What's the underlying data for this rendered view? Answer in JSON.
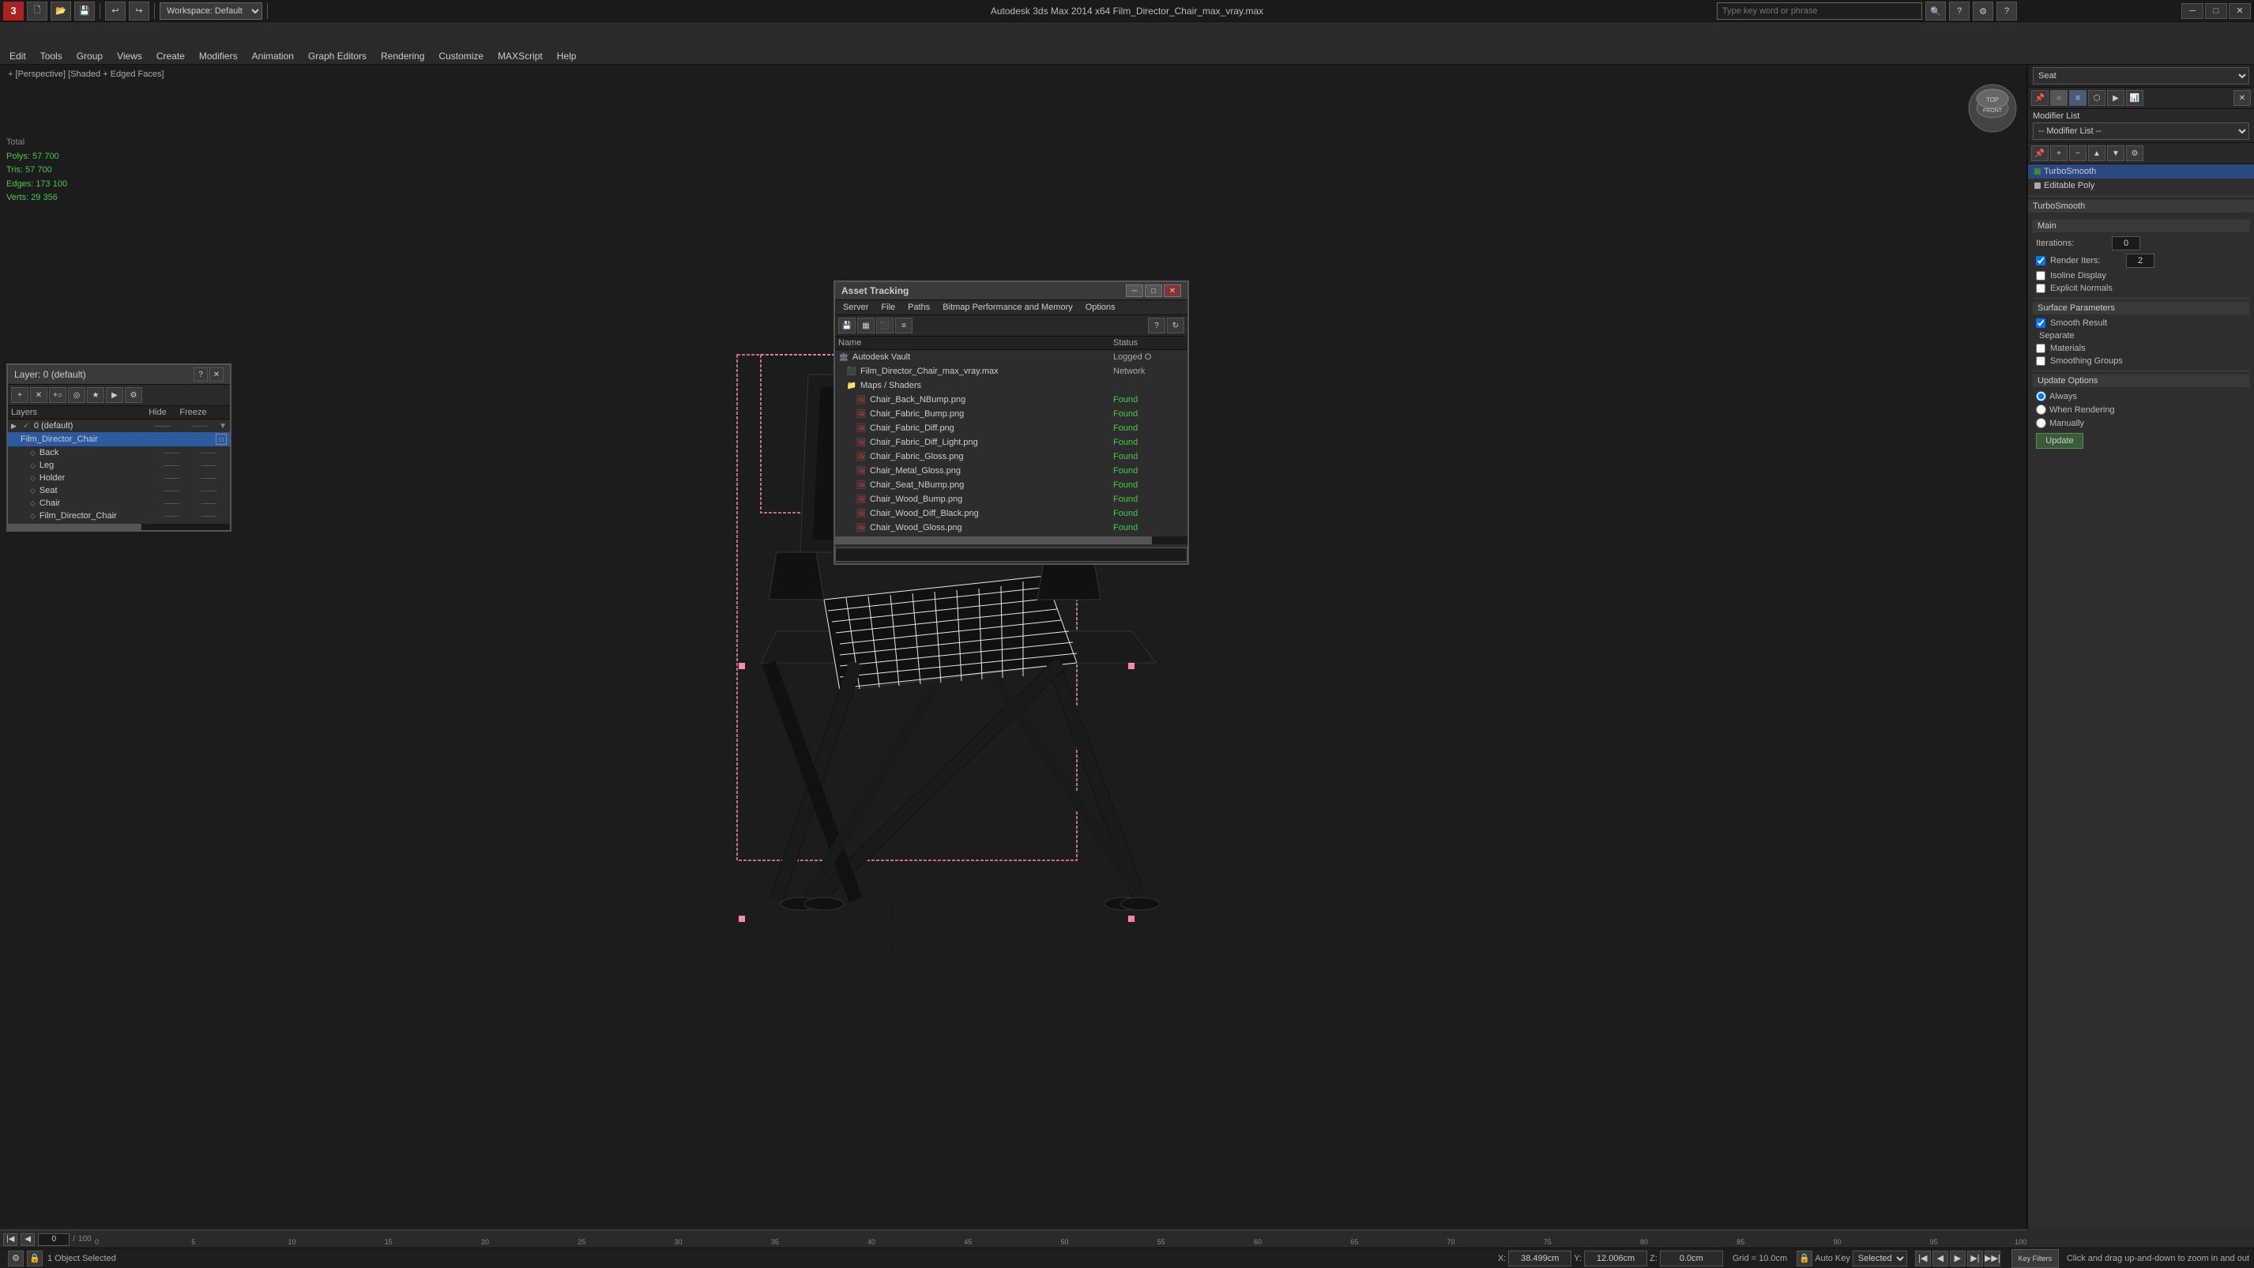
{
  "app": {
    "title": "Autodesk 3ds Max 2014 x64",
    "file": "Film_Director_Chair_max_vray.max",
    "full_title": "Autodesk 3ds Max 2014 x64    Film_Director_Chair_max_vray.max"
  },
  "titlebar": {
    "minimize": "─",
    "maximize": "□",
    "close": "✕",
    "logo": "3"
  },
  "toolbar": {
    "workspace_label": "Workspace: Default",
    "search_placeholder": "Type key word or phrase"
  },
  "menubar": {
    "items": [
      "Edit",
      "Tools",
      "Group",
      "Views",
      "Create",
      "Modifiers",
      "Animation",
      "Graph Editors",
      "Rendering",
      "Customize",
      "MAXScript",
      "Help"
    ]
  },
  "viewport": {
    "label": "+ [Perspective] [Shaded + Edged Faces]"
  },
  "stats": {
    "total_label": "Total",
    "polys_label": "Polys:",
    "polys_value": "57 700",
    "tris_label": "Tris:",
    "tris_value": "57 700",
    "edges_label": "Edges:",
    "edges_value": "173 100",
    "verts_label": "Verts:",
    "verts_value": "29 356"
  },
  "right_panel": {
    "name_label": "Seat",
    "modifier_list_label": "Modifier List",
    "modifiers": [
      {
        "name": "TurboSmooth",
        "type": "green"
      },
      {
        "name": "Editable Poly",
        "type": "white"
      }
    ],
    "turbosmooth": {
      "title": "TurboSmooth",
      "main_label": "Main",
      "iterations_label": "Iterations:",
      "iterations_value": "0",
      "render_iters_label": "Render Iters:",
      "render_iters_value": "2",
      "isoline_label": "Isoline Display",
      "explicit_label": "Explicit Normals",
      "surface_params_label": "Surface Parameters",
      "smooth_result_label": "Smooth Result",
      "separate_label": "Separate",
      "materials_label": "Materials",
      "smoothing_label": "Smoothing Groups",
      "update_options_label": "Update Options",
      "always_label": "Always",
      "when_rendering_label": "When Rendering",
      "manually_label": "Manually",
      "update_btn": "Update"
    },
    "panel_tabs": [
      "pin",
      "obj",
      "mod",
      "hier",
      "motion",
      "disp"
    ]
  },
  "layer_panel": {
    "title": "Layer: 0 (default)",
    "layers": [
      {
        "name": "0 (default)",
        "level": 0,
        "selected": false,
        "has_arrow": true
      },
      {
        "name": "Film_Director_Chair",
        "level": 1,
        "selected": true
      },
      {
        "name": "Back",
        "level": 2,
        "selected": false
      },
      {
        "name": "Leg",
        "level": 2,
        "selected": false
      },
      {
        "name": "Holder",
        "level": 2,
        "selected": false
      },
      {
        "name": "Seat",
        "level": 2,
        "selected": false
      },
      {
        "name": "Chair",
        "level": 2,
        "selected": false
      },
      {
        "name": "Film_Director_Chair",
        "level": 2,
        "selected": false
      }
    ],
    "columns": {
      "name": "Layers",
      "hide": "Hide",
      "freeze": "Freeze"
    }
  },
  "asset_tracking": {
    "title": "Asset Tracking",
    "menus": [
      "Server",
      "File",
      "Paths",
      "Bitmap Performance and Memory",
      "Options"
    ],
    "columns": {
      "name": "Name",
      "status": "Status"
    },
    "rows": [
      {
        "name": "Autodesk Vault",
        "status": "Logged O",
        "level": 0,
        "icon": "vault"
      },
      {
        "name": "Film_Director_Chair_max_vray.max",
        "status": "Network",
        "level": 1,
        "icon": "file"
      },
      {
        "name": "Maps / Shaders",
        "status": "",
        "level": 1,
        "icon": "folder"
      },
      {
        "name": "Chair_Back_NBump.png",
        "status": "Found",
        "level": 2,
        "icon": "img"
      },
      {
        "name": "Chair_Fabric_Bump.png",
        "status": "Found",
        "level": 2,
        "icon": "img"
      },
      {
        "name": "Chair_Fabric_Diff.png",
        "status": "Found",
        "level": 2,
        "icon": "img"
      },
      {
        "name": "Chair_Fabric_Diff_Light.png",
        "status": "Found",
        "level": 2,
        "icon": "img"
      },
      {
        "name": "Chair_Fabric_Gloss.png",
        "status": "Found",
        "level": 2,
        "icon": "img"
      },
      {
        "name": "Chair_Metal_Gloss.png",
        "status": "Found",
        "level": 2,
        "icon": "img"
      },
      {
        "name": "Chair_Seat_NBump.png",
        "status": "Found",
        "level": 2,
        "icon": "img"
      },
      {
        "name": "Chair_Wood_Bump.png",
        "status": "Found",
        "level": 2,
        "icon": "img"
      },
      {
        "name": "Chair_Wood_Diff_Black.png",
        "status": "Found",
        "level": 2,
        "icon": "img"
      },
      {
        "name": "Chair_Wood_Gloss.png",
        "status": "Found",
        "level": 2,
        "icon": "img"
      }
    ]
  },
  "statusbar": {
    "object_selected": "1 Object Selected",
    "hint": "Click and drag up-and-down to zoom in and out",
    "x_label": "X:",
    "x_value": "38.499cm",
    "y_label": "Y:",
    "y_value": "12.006cm",
    "z_label": "Z:",
    "z_value": "0.0cm",
    "grid_label": "Grid = 10.0cm",
    "autokey_label": "Auto Key",
    "selected_label": "Selected",
    "frame_value": "0",
    "frame_max": "100"
  },
  "timeline": {
    "ticks": [
      "0",
      "5",
      "10",
      "15",
      "20",
      "25",
      "30",
      "35",
      "40",
      "45",
      "50",
      "55",
      "60",
      "65",
      "70",
      "75",
      "80",
      "85",
      "90",
      "95",
      "100"
    ]
  }
}
